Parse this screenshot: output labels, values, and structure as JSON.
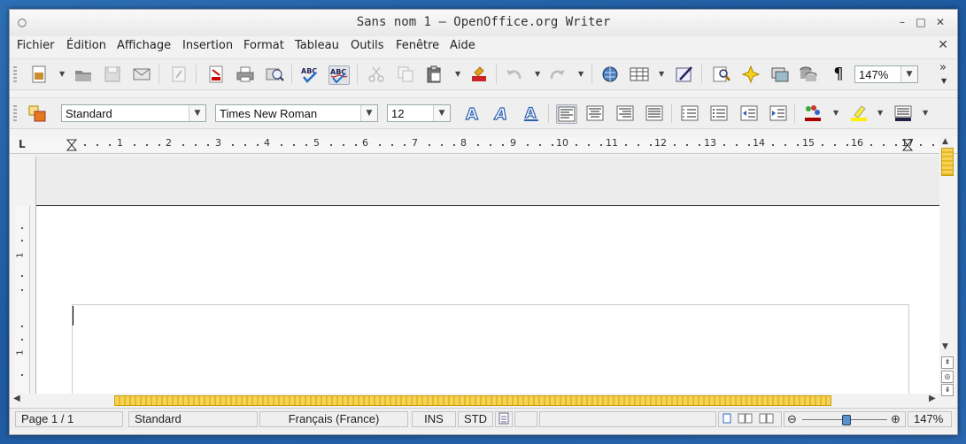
{
  "window": {
    "title": "Sans nom 1 — OpenOffice.org Writer",
    "menu_icon": "circle-icon",
    "minimize_glyph": "–",
    "maximize_glyph": "□",
    "close_glyph": "✕"
  },
  "menu": {
    "items": [
      "Fichier",
      "Édition",
      "Affichage",
      "Insertion",
      "Format",
      "Tableau",
      "Outils",
      "Fenêtre",
      "Aide"
    ],
    "close_document": "✕"
  },
  "standard_toolbar": {
    "icons": [
      "new-document-icon",
      "open-icon",
      "save-icon",
      "email-icon",
      "edit-file-icon",
      "export-pdf-icon",
      "print-icon",
      "page-preview-icon",
      "spellcheck-icon",
      "autospellcheck-icon",
      "cut-icon",
      "copy-icon",
      "paste-icon",
      "clone-formatting-icon",
      "undo-icon",
      "redo-icon",
      "hyperlink-icon",
      "table-icon",
      "show-draw-functions-icon",
      "find-replace-icon",
      "navigator-icon",
      "gallery-icon",
      "data-sources-icon",
      "formatting-marks-icon"
    ],
    "formatting_marks_glyph": "¶",
    "zoom": "147%",
    "overflow_glyph": "»"
  },
  "formatting_toolbar": {
    "paragraph_style": "Standard",
    "font_name": "Times New Roman",
    "font_size": "12",
    "icons": [
      "styles-formatting-icon",
      "bold-icon",
      "italic-icon",
      "underline-icon",
      "align-left-icon",
      "align-center-icon",
      "align-right-icon",
      "justify-icon",
      "numbering-icon",
      "bullets-icon",
      "decrease-indent-icon",
      "increase-indent-icon",
      "font-color-icon",
      "highlighting-icon",
      "background-color-icon"
    ]
  },
  "ruler": {
    "corner": "L",
    "numbers": [
      "1",
      "2",
      "3",
      "4",
      "5",
      "6",
      "7",
      "8",
      "9",
      "10",
      "11",
      "12",
      "13",
      "14",
      "15",
      "16",
      "17"
    ]
  },
  "vertical_ruler": {
    "numbers": [
      "1",
      "1"
    ]
  },
  "status_bar": {
    "page": "Page 1 / 1",
    "style": "Standard",
    "language": "Français (France)",
    "insert_mode": "INS",
    "selection_mode": "STD",
    "zoom": "147%",
    "zoom_out": "⊖",
    "zoom_in": "⊕"
  }
}
